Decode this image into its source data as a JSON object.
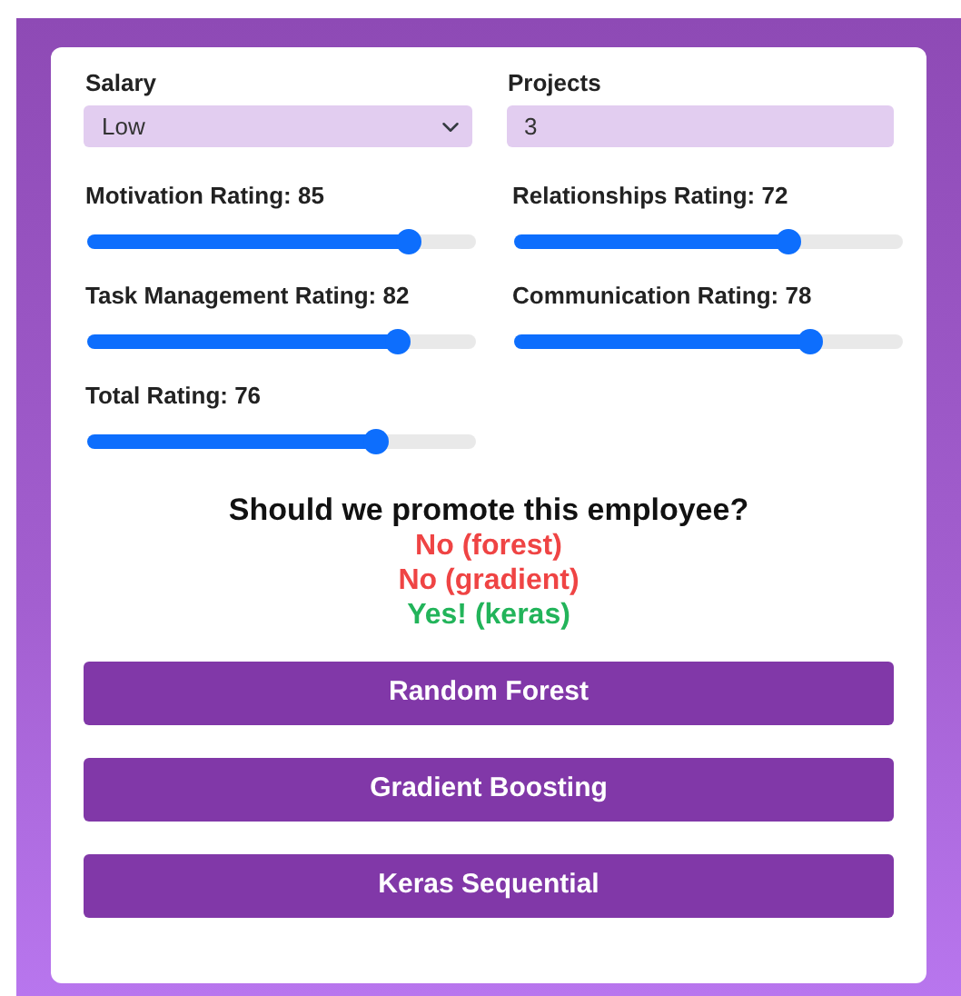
{
  "fields": [
    {
      "label": "Salary",
      "kind": "select",
      "value": "Low"
    },
    {
      "label": "Projects",
      "kind": "input",
      "value": "3"
    }
  ],
  "ratings": [
    {
      "label": "Motivation Rating: 85",
      "level": 0.85
    },
    {
      "label": "Relationships Rating: 72",
      "level": 0.72
    },
    {
      "label": "Task Management Rating: 82",
      "level": 0.82
    },
    {
      "label": "Communication Rating: 78",
      "level": 0.78
    },
    {
      "label": "Total Rating: 76",
      "level": 0.76
    }
  ],
  "question": "Should we promote this employee?",
  "results": [
    {
      "text": "No (forest)",
      "color": "#ef4444"
    },
    {
      "text": "No (gradient)",
      "color": "#ef4444"
    },
    {
      "text": "Yes! (keras)",
      "color": "#22b45a"
    }
  ],
  "buttons": [
    "Random Forest",
    "Gradient Boosting",
    "Keras Sequential"
  ]
}
